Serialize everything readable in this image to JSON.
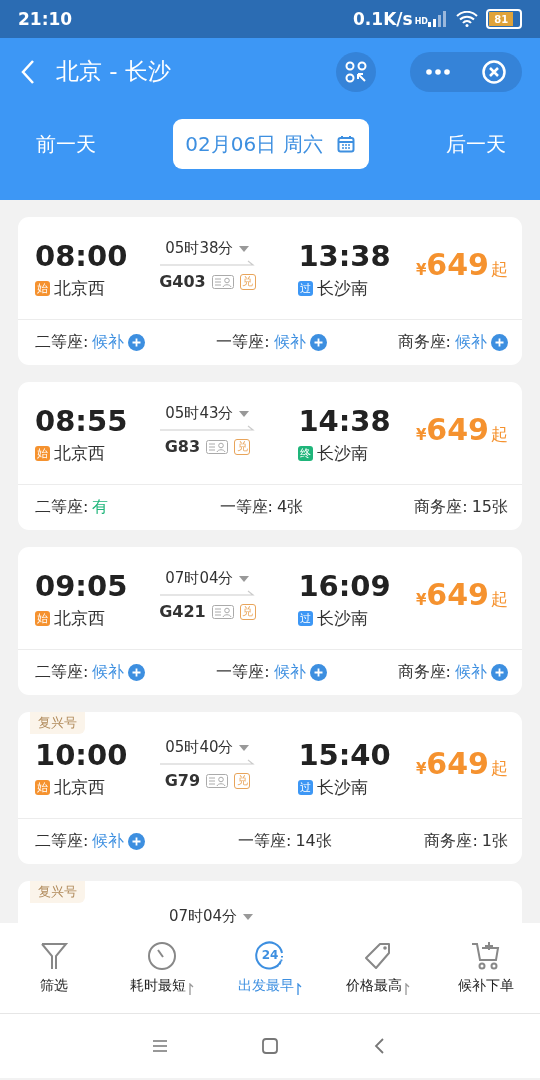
{
  "status_bar": {
    "time": "21:10",
    "speed": "0.1K/s",
    "network": "HD",
    "battery": "81"
  },
  "header": {
    "title": "北京 - 长沙",
    "prev_day": "前一天",
    "date": "02月06日 周六",
    "next_day": "后一天"
  },
  "trains": [
    {
      "dep_time": "08:00",
      "dep_tag": {
        "text": "始",
        "color": "#f5922f"
      },
      "dep_station": "北京西",
      "duration": "05时38分",
      "train_no": "G403",
      "exchange": "兑",
      "arr_time": "13:38",
      "arr_tag": {
        "text": "过",
        "color": "#3d97f5"
      },
      "arr_station": "长沙南",
      "currency": "¥",
      "price": "649",
      "price_suffix": "起",
      "seats": [
        {
          "label": "二等座:",
          "value": "候补",
          "kind": "waitlist"
        },
        {
          "label": "一等座:",
          "value": "候补",
          "kind": "waitlist"
        },
        {
          "label": "商务座:",
          "value": "候补",
          "kind": "waitlist"
        }
      ]
    },
    {
      "dep_time": "08:55",
      "dep_tag": {
        "text": "始",
        "color": "#f5922f"
      },
      "dep_station": "北京西",
      "duration": "05时43分",
      "train_no": "G83",
      "exchange": "兑",
      "arr_time": "14:38",
      "arr_tag": {
        "text": "终",
        "color": "#1fb57a"
      },
      "arr_station": "长沙南",
      "currency": "¥",
      "price": "649",
      "price_suffix": "起",
      "seats": [
        {
          "label": "二等座:",
          "value": "有",
          "kind": "available"
        },
        {
          "label": "一等座:",
          "value": "4张",
          "kind": "count"
        },
        {
          "label": "商务座:",
          "value": "15张",
          "kind": "count"
        }
      ]
    },
    {
      "dep_time": "09:05",
      "dep_tag": {
        "text": "始",
        "color": "#f5922f"
      },
      "dep_station": "北京西",
      "duration": "07时04分",
      "train_no": "G421",
      "exchange": "兑",
      "arr_time": "16:09",
      "arr_tag": {
        "text": "过",
        "color": "#3d97f5"
      },
      "arr_station": "长沙南",
      "currency": "¥",
      "price": "649",
      "price_suffix": "起",
      "seats": [
        {
          "label": "二等座:",
          "value": "候补",
          "kind": "waitlist"
        },
        {
          "label": "一等座:",
          "value": "候补",
          "kind": "waitlist"
        },
        {
          "label": "商务座:",
          "value": "候补",
          "kind": "waitlist"
        }
      ]
    },
    {
      "badge": "复兴号",
      "dep_time": "10:00",
      "dep_tag": {
        "text": "始",
        "color": "#f5922f"
      },
      "dep_station": "北京西",
      "duration": "05时40分",
      "train_no": "G79",
      "exchange": "兑",
      "arr_time": "15:40",
      "arr_tag": {
        "text": "过",
        "color": "#3d97f5"
      },
      "arr_station": "长沙南",
      "currency": "¥",
      "price": "649",
      "price_suffix": "起",
      "seats": [
        {
          "label": "二等座:",
          "value": "候补",
          "kind": "waitlist"
        },
        {
          "label": "一等座:",
          "value": "14张",
          "kind": "count"
        },
        {
          "label": "商务座:",
          "value": "1张",
          "kind": "count"
        }
      ]
    },
    {
      "badge": "复兴号",
      "duration": "07时04分"
    }
  ],
  "bottom_tabs": [
    {
      "label": "筛选",
      "kind": "filter",
      "selected": false,
      "sortable": false
    },
    {
      "label": "耗时最短",
      "kind": "duration",
      "selected": false,
      "sortable": true
    },
    {
      "label": "出发最早",
      "kind": "time",
      "icon_text": "24",
      "selected": true,
      "sortable": true
    },
    {
      "label": "价格最高",
      "kind": "price",
      "selected": false,
      "sortable": true
    },
    {
      "label": "候补下单",
      "kind": "cart",
      "selected": false,
      "sortable": false
    }
  ]
}
